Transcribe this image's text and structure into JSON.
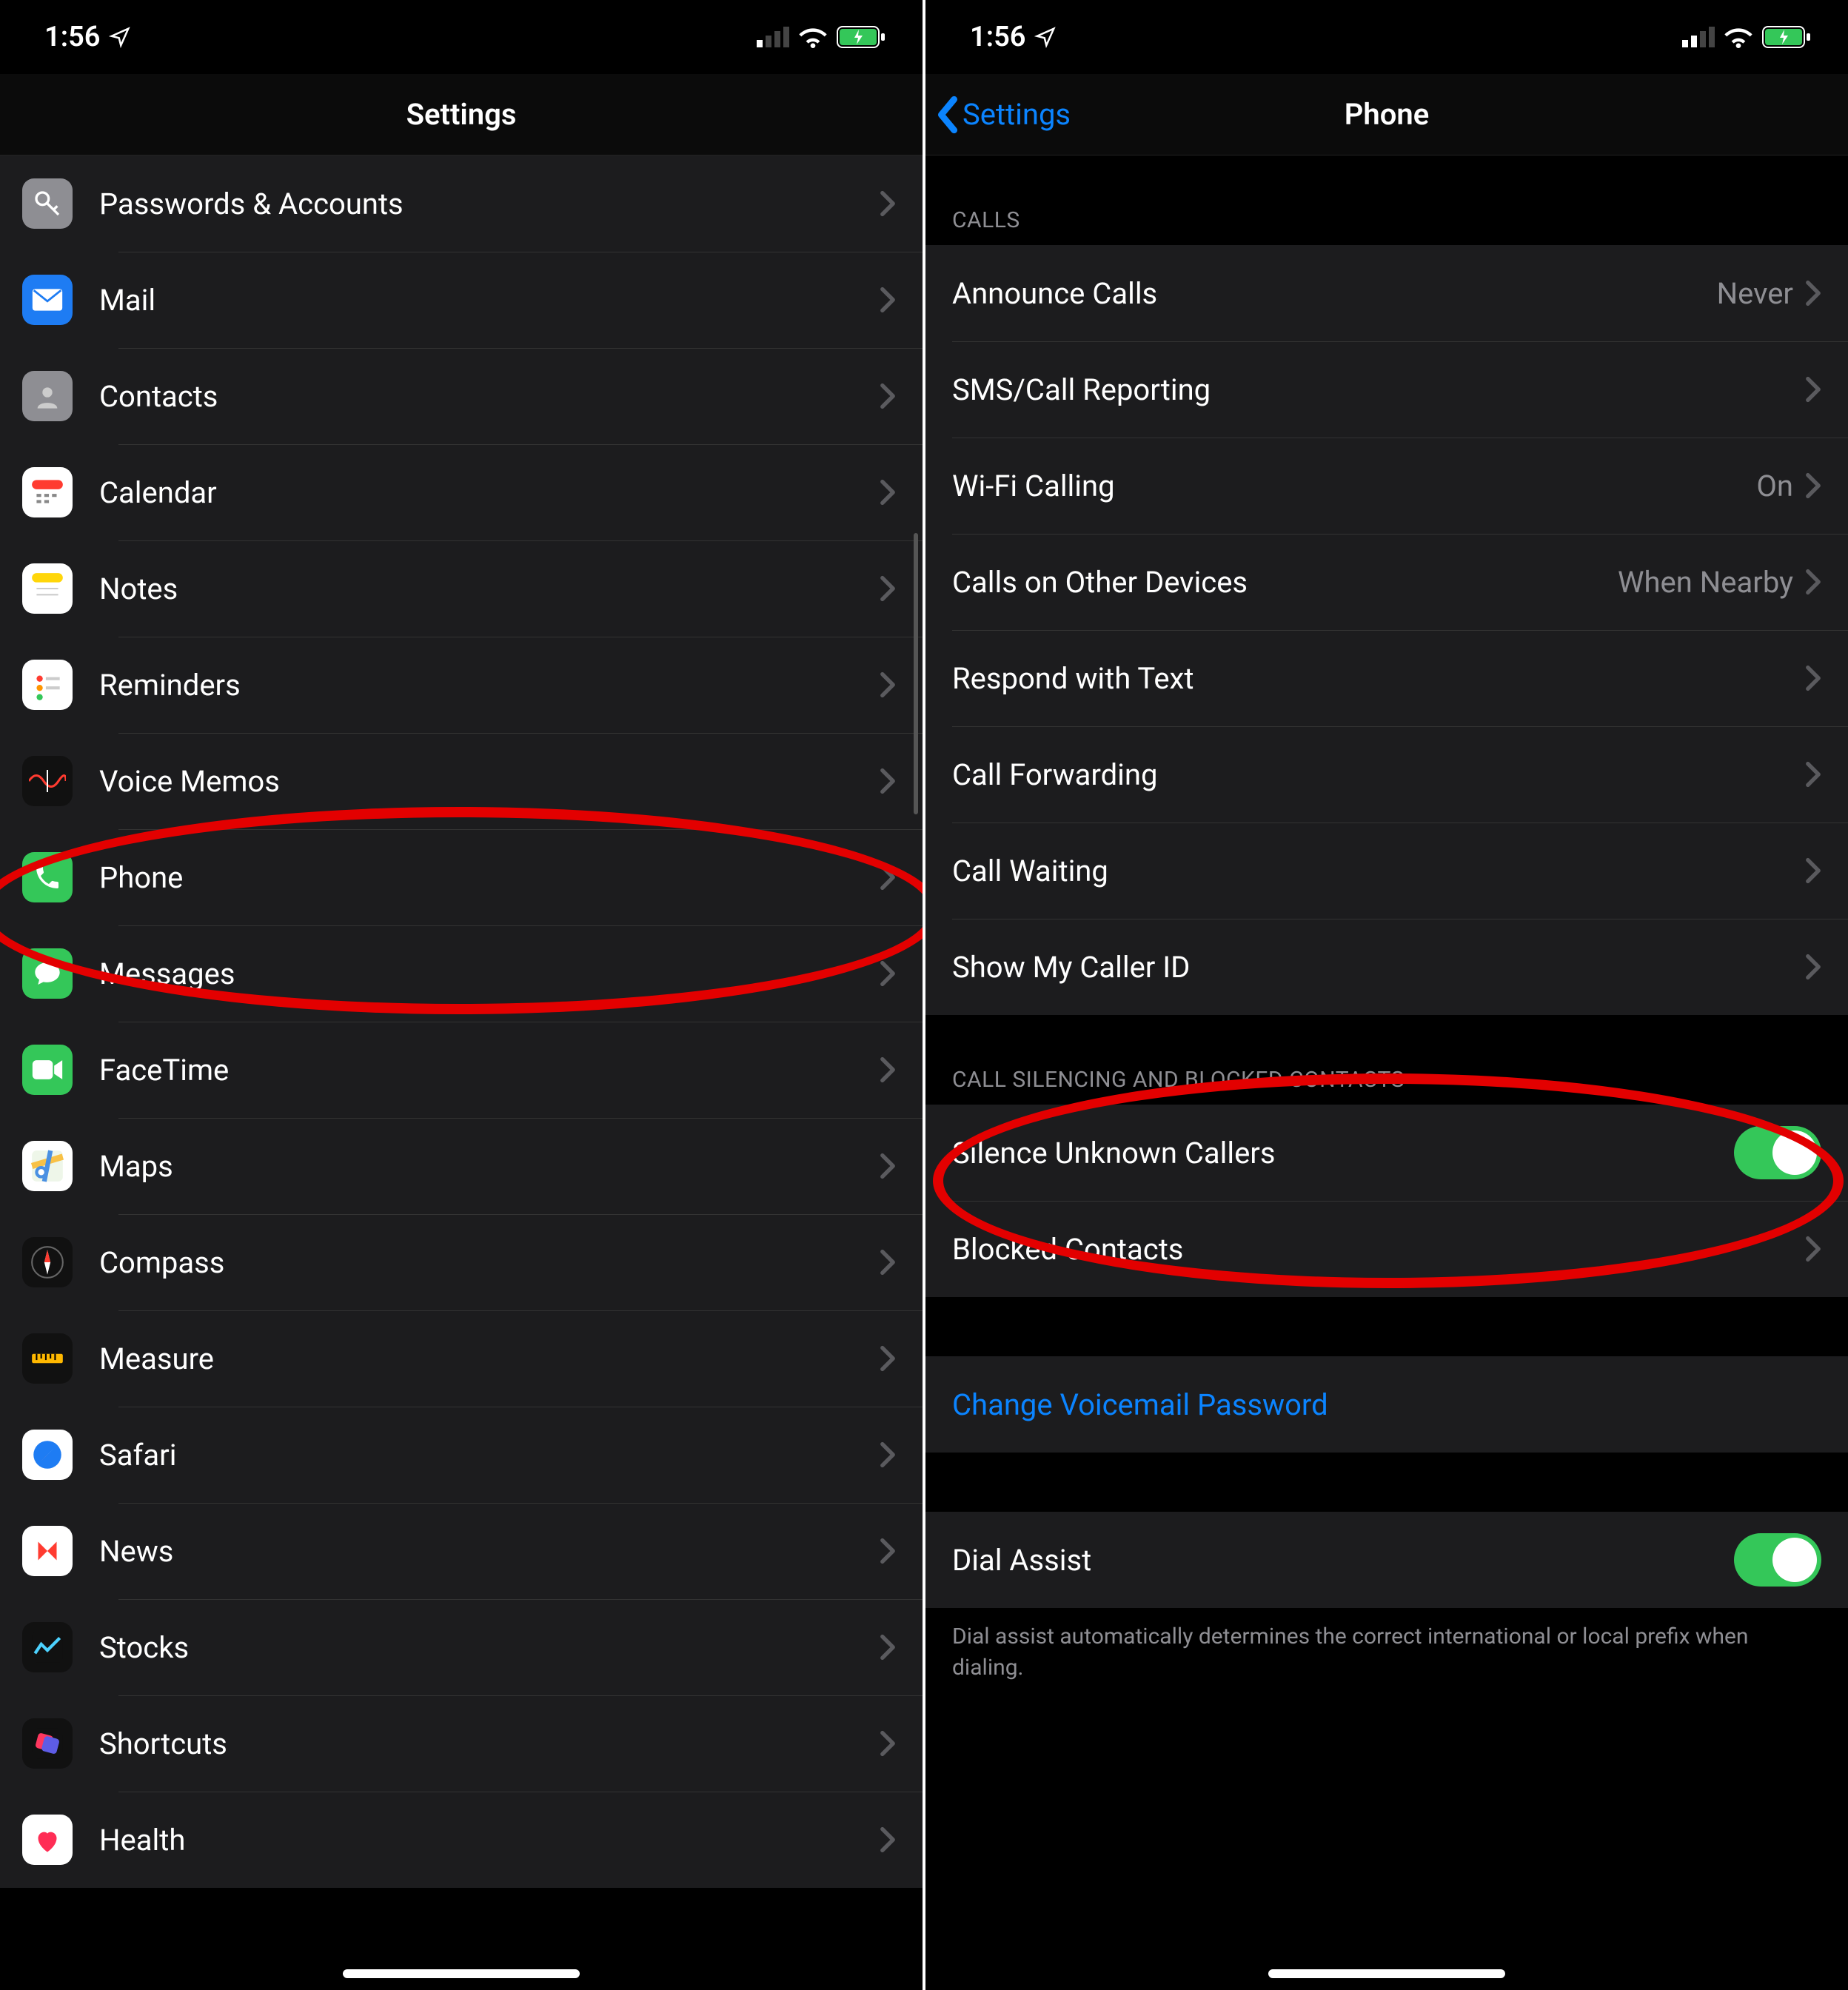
{
  "status": {
    "time": "1:56"
  },
  "left": {
    "title": "Settings",
    "items": [
      {
        "id": "passwords",
        "label": "Passwords & Accounts",
        "icon": "key",
        "bg": "#8e8e93"
      },
      {
        "id": "mail",
        "label": "Mail",
        "icon": "mail",
        "bg": "#1e7cf3"
      },
      {
        "id": "contacts",
        "label": "Contacts",
        "icon": "contacts",
        "bg": "#8e8e93"
      },
      {
        "id": "calendar",
        "label": "Calendar",
        "icon": "calendar",
        "bg": "#ffffff"
      },
      {
        "id": "notes",
        "label": "Notes",
        "icon": "notes",
        "bg": "#fff"
      },
      {
        "id": "reminders",
        "label": "Reminders",
        "icon": "reminders",
        "bg": "#fff"
      },
      {
        "id": "voicememos",
        "label": "Voice Memos",
        "icon": "voicememos",
        "bg": "#111"
      },
      {
        "id": "phone",
        "label": "Phone",
        "icon": "phone",
        "bg": "#34c759"
      },
      {
        "id": "messages",
        "label": "Messages",
        "icon": "messages",
        "bg": "#34c759"
      },
      {
        "id": "facetime",
        "label": "FaceTime",
        "icon": "facetime",
        "bg": "#34c759"
      },
      {
        "id": "maps",
        "label": "Maps",
        "icon": "maps",
        "bg": "#fff"
      },
      {
        "id": "compass",
        "label": "Compass",
        "icon": "compass",
        "bg": "#111"
      },
      {
        "id": "measure",
        "label": "Measure",
        "icon": "measure",
        "bg": "#111"
      },
      {
        "id": "safari",
        "label": "Safari",
        "icon": "safari",
        "bg": "#fff"
      },
      {
        "id": "news",
        "label": "News",
        "icon": "news",
        "bg": "#fff"
      },
      {
        "id": "stocks",
        "label": "Stocks",
        "icon": "stocks",
        "bg": "#111"
      },
      {
        "id": "shortcuts",
        "label": "Shortcuts",
        "icon": "shortcuts",
        "bg": "#111"
      },
      {
        "id": "health",
        "label": "Health",
        "icon": "health",
        "bg": "#fff"
      }
    ]
  },
  "right": {
    "back": "Settings",
    "title": "Phone",
    "sections": {
      "calls_header": "CALLS",
      "calls": [
        {
          "id": "announce",
          "label": "Announce Calls",
          "value": "Never",
          "chev": true
        },
        {
          "id": "smsreport",
          "label": "SMS/Call Reporting",
          "chev": true
        },
        {
          "id": "wifi",
          "label": "Wi-Fi Calling",
          "value": "On",
          "chev": true
        },
        {
          "id": "otherdev",
          "label": "Calls on Other Devices",
          "value": "When Nearby",
          "chev": true
        },
        {
          "id": "respond",
          "label": "Respond with Text",
          "chev": true
        },
        {
          "id": "forward",
          "label": "Call Forwarding",
          "chev": true
        },
        {
          "id": "waiting",
          "label": "Call Waiting",
          "chev": true
        },
        {
          "id": "callerid",
          "label": "Show My Caller ID",
          "chev": true
        }
      ],
      "silencing_header": "CALL SILENCING AND BLOCKED CONTACTS",
      "silencing": [
        {
          "id": "silence",
          "label": "Silence Unknown Callers",
          "toggle": true
        },
        {
          "id": "blocked",
          "label": "Blocked Contacts",
          "chev": true
        }
      ],
      "voicemail": {
        "label": "Change Voicemail Password"
      },
      "dial": {
        "label": "Dial Assist",
        "toggle": true
      },
      "dial_footer": "Dial assist automatically determines the correct international or local prefix when dialing."
    }
  }
}
